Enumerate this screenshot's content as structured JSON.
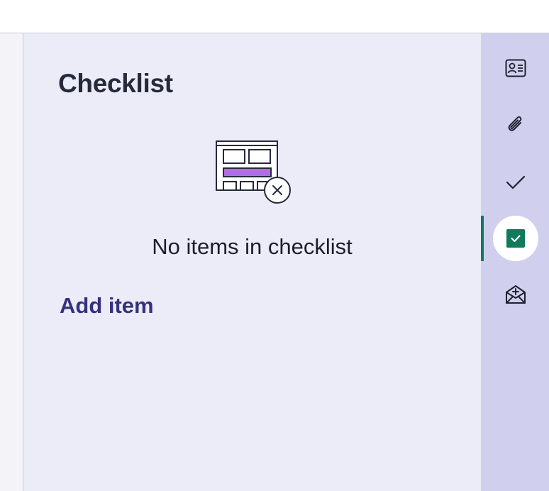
{
  "panel": {
    "title": "Checklist",
    "empty_message": "No items in checklist",
    "add_item_label": "Add item"
  },
  "rail": {
    "items": [
      {
        "icon": "contact-card-icon",
        "active": false
      },
      {
        "icon": "paperclip-icon",
        "active": false
      },
      {
        "icon": "checkmark-icon",
        "active": false
      },
      {
        "icon": "checkbox-checked-icon",
        "active": true
      },
      {
        "icon": "email-add-icon",
        "active": false
      }
    ]
  },
  "colors": {
    "accent": "#0f7a5c",
    "link": "#34317f",
    "rail_bg": "#d0d0ee",
    "panel_bg": "#ebecf7",
    "illustration_highlight": "#b06ee3"
  }
}
